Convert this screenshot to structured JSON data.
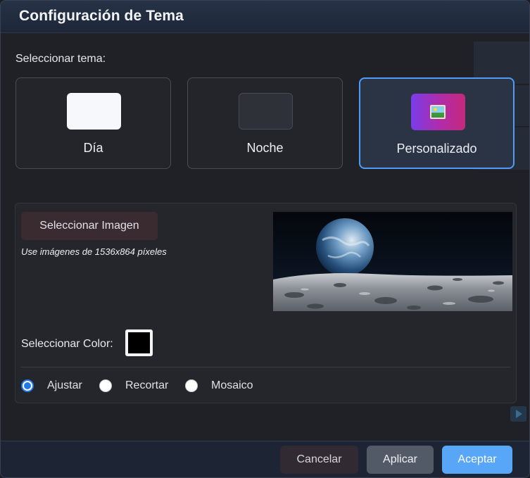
{
  "dialog": {
    "title": "Configuración de Tema"
  },
  "theme": {
    "section_label": "Seleccionar tema:",
    "options": [
      {
        "label": "Día",
        "icon": "light-swatch-icon",
        "selected": false
      },
      {
        "label": "Noche",
        "icon": "dark-swatch-icon",
        "selected": false
      },
      {
        "label": "Personalizado",
        "icon": "image-icon",
        "selected": true
      }
    ]
  },
  "custom": {
    "select_image_label": "Seleccionar Imagen",
    "hint": "Use imágenes de 1536x864 píxeles",
    "preview_icon": "moon-earth-preview-image",
    "color_label": "Seleccionar Color:",
    "color_value": "#000000",
    "fit_options": [
      {
        "label": "Ajustar",
        "checked": true
      },
      {
        "label": "Recortar",
        "checked": false
      },
      {
        "label": "Mosaico",
        "checked": false
      }
    ]
  },
  "footer": {
    "cancel_label": "Cancelar",
    "apply_label": "Aplicar",
    "accept_label": "Aceptar"
  },
  "colors": {
    "accent": "#4f9cf9",
    "accept_button": "#57a6f7",
    "radio_checked": "#1f7ae8"
  }
}
